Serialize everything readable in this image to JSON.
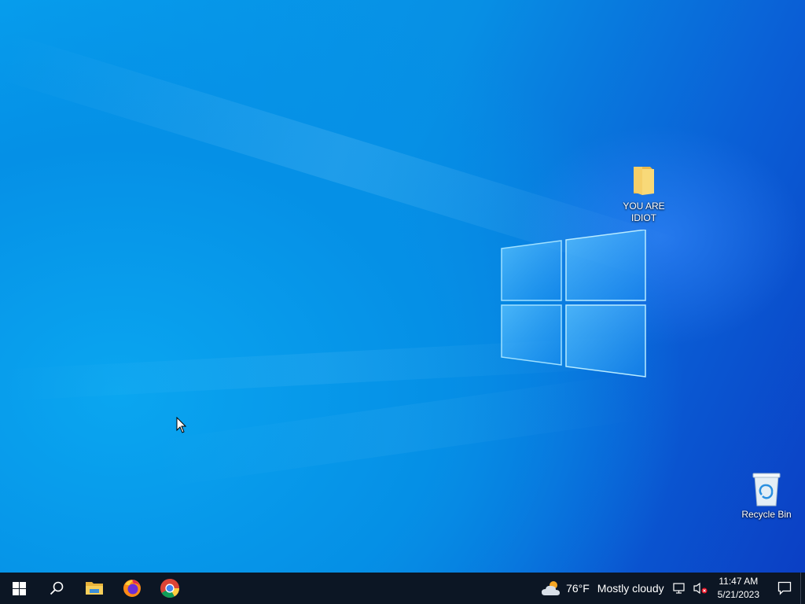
{
  "desktop": {
    "icons": [
      {
        "label": "YOU ARE IDIOT",
        "type": "folder-icon"
      },
      {
        "label": "Recycle Bin",
        "type": "recycle-bin-icon"
      }
    ]
  },
  "taskbar": {
    "pinned": [
      "start-button",
      "search-icon",
      "file-explorer-icon",
      "firefox-icon",
      "chrome-icon"
    ],
    "weather": {
      "temperature": "76°F",
      "condition": "Mostly cloudy",
      "icon": "cloudy-weather-icon"
    },
    "tray_icons": [
      "network-icon",
      "volume-muted-icon"
    ],
    "clock": {
      "time": "11:47 AM",
      "date": "5/21/2023"
    },
    "notifications_icon": "action-center-icon"
  },
  "colors": {
    "taskbar_bg": "#0c1624",
    "desktop_blue": "#078fe4"
  }
}
